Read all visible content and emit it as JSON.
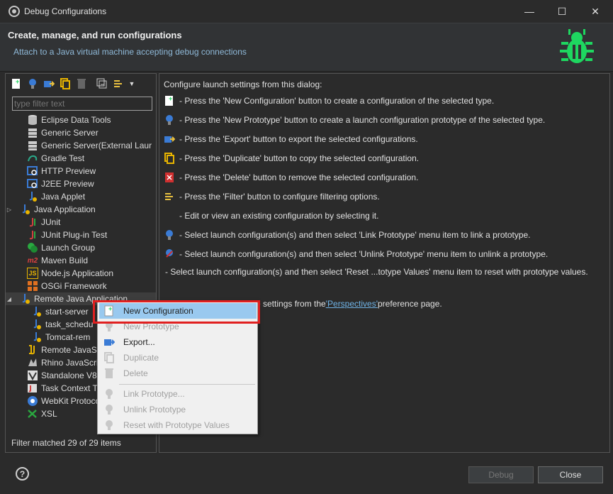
{
  "window": {
    "title": "Debug Configurations"
  },
  "header": {
    "title": "Create, manage, and run configurations",
    "subtitle": "Attach to a Java virtual machine accepting debug connections"
  },
  "left": {
    "filter_placeholder": "type filter text",
    "status": "Filter matched 29 of 29 items",
    "tree": [
      {
        "label": "Eclipse Data Tools",
        "icon": "database-icon"
      },
      {
        "label": "Generic Server",
        "icon": "server-icon"
      },
      {
        "label": "Generic Server(External Laur",
        "icon": "server-icon"
      },
      {
        "label": "Gradle Test",
        "icon": "gradle-icon"
      },
      {
        "label": "HTTP Preview",
        "icon": "preview-icon"
      },
      {
        "label": "J2EE Preview",
        "icon": "preview-icon"
      },
      {
        "label": "Java Applet",
        "icon": "java-icon"
      },
      {
        "label": "Java Application",
        "icon": "java-icon"
      },
      {
        "label": "JUnit",
        "icon": "junit-icon"
      },
      {
        "label": "JUnit Plug-in Test",
        "icon": "junit-icon"
      },
      {
        "label": "Launch Group",
        "icon": "launch-group-icon"
      },
      {
        "label": "Maven Build",
        "icon": "maven-icon"
      },
      {
        "label": "Node.js Application",
        "icon": "nodejs-icon"
      },
      {
        "label": "OSGi Framework",
        "icon": "osgi-icon"
      },
      {
        "label": "Remote Java Application",
        "icon": "java-icon"
      },
      {
        "label": "start-server",
        "icon": "java-icon"
      },
      {
        "label": "task_schedu",
        "icon": "java-icon"
      },
      {
        "label": "Tomcat-rem",
        "icon": "java-icon"
      },
      {
        "label": "Remote JavaSc",
        "icon": "js-icon"
      },
      {
        "label": "Rhino JavaScrip",
        "icon": "rhino-icon"
      },
      {
        "label": "Standalone V8",
        "icon": "v8-icon"
      },
      {
        "label": "Task Context Te",
        "icon": "task-icon"
      },
      {
        "label": "WebKit Protoco",
        "icon": "chrome-icon"
      },
      {
        "label": "XSL",
        "icon": "xsl-icon"
      }
    ]
  },
  "right": {
    "intro": "Configure launch settings from this dialog:",
    "lines": [
      "- Press the 'New Configuration' button to create a configuration of the selected type.",
      "- Press the 'New Prototype' button to create a launch configuration prototype of the selected type.",
      "- Press the 'Export' button to export the selected configurations.",
      "- Press the 'Duplicate' button to copy the selected configuration.",
      "- Press the 'Delete' button to remove the selected configuration.",
      "- Press the 'Filter' button to configure filtering options.",
      "- Edit or view an existing configuration by selecting it.",
      "- Select launch configuration(s) and then select 'Link Prototype' menu item to link a prototype.",
      "- Select launch configuration(s) and then select 'Unlink Prototype' menu item to unlink a prototype.",
      "- Select launch configuration(s) and then select 'Reset ...totype Values' menu item to reset with prototype values."
    ],
    "perspective_pre": "tive settings from the ",
    "perspective_link": "'Perspectives'",
    "perspective_post": " preference page."
  },
  "context_menu": {
    "items": [
      {
        "label": "New Configuration",
        "enabled": true
      },
      {
        "label": "New Prototype",
        "enabled": false
      },
      {
        "label": "Export...",
        "enabled": true
      },
      {
        "label": "Duplicate",
        "enabled": false
      },
      {
        "label": "Delete",
        "enabled": false
      },
      {
        "label": "Link Prototype...",
        "enabled": false
      },
      {
        "label": "Unlink Prototype",
        "enabled": false
      },
      {
        "label": "Reset with Prototype Values",
        "enabled": false
      }
    ]
  },
  "buttons": {
    "debug": "Debug",
    "close": "Close"
  },
  "colors": {
    "accent_green": "#1ed760",
    "highlight": "#99c9ef",
    "annotation_red": "#e02020"
  }
}
